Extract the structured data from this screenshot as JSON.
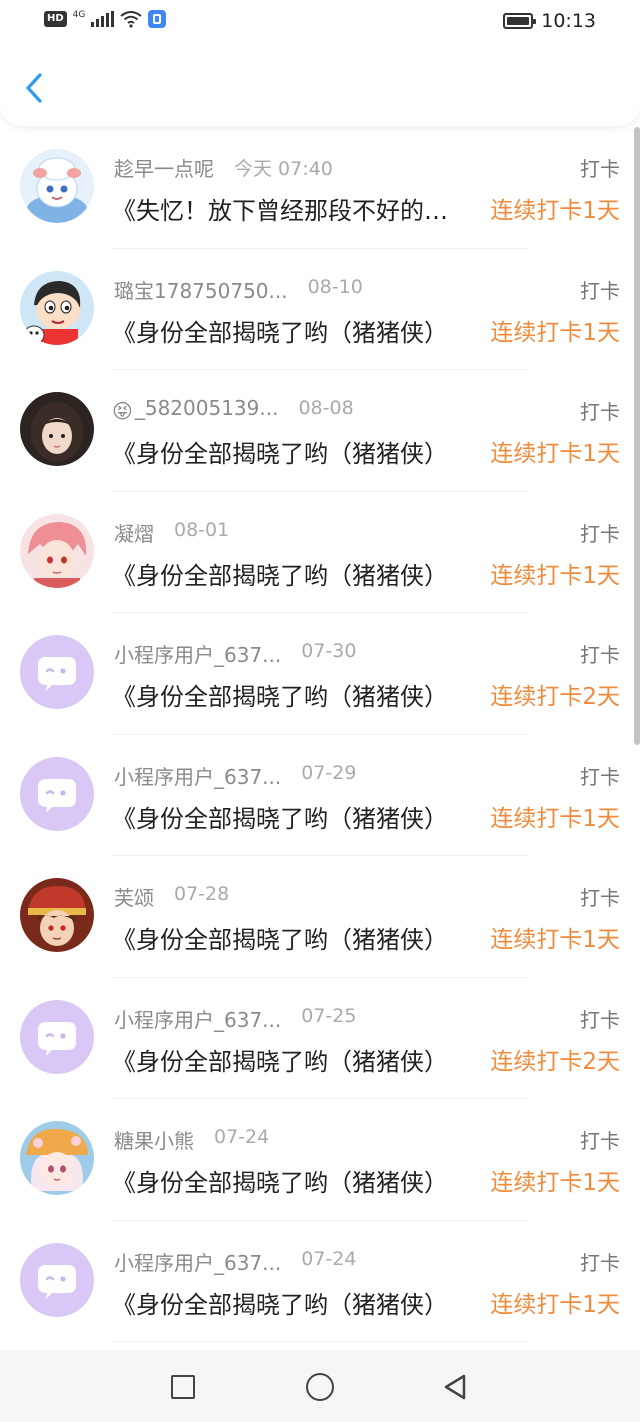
{
  "status_bar": {
    "hd": "HD",
    "network": "4G",
    "time": "10:13",
    "icons": [
      "signal-icon",
      "wifi-icon",
      "app-notification-icon",
      "battery-icon"
    ]
  },
  "header": {
    "back_icon": "chevron-left-icon"
  },
  "records": [
    {
      "username": "趁早一点呢",
      "emoji": "",
      "time": "今天 07:40",
      "type": "打卡",
      "title": "《失忆！放下曾经那段不好的回忆",
      "streak": "连续打卡1天",
      "avatar": "sheep-cartoon"
    },
    {
      "username": "璐宝178750750...",
      "emoji": "",
      "time": "08-10",
      "type": "打卡",
      "title": "《身份全部揭晓了哟（猪猪侠）",
      "streak": "连续打卡1天",
      "avatar": "crayon-boy"
    },
    {
      "username": "_582005139...",
      "emoji": "😝",
      "time": "08-08",
      "type": "打卡",
      "title": "《身份全部揭晓了哟（猪猪侠）",
      "streak": "连续打卡1天",
      "avatar": "girl-photo"
    },
    {
      "username": "凝熠",
      "emoji": "",
      "time": "08-01",
      "type": "打卡",
      "title": "《身份全部揭晓了哟（猪猪侠）",
      "streak": "连续打卡1天",
      "avatar": "pink-hair-anime"
    },
    {
      "username": "小程序用户_637...",
      "emoji": "",
      "time": "07-30",
      "type": "打卡",
      "title": "《身份全部揭晓了哟（猪猪侠）",
      "streak": "连续打卡2天",
      "avatar": "default"
    },
    {
      "username": "小程序用户_637...",
      "emoji": "",
      "time": "07-29",
      "type": "打卡",
      "title": "《身份全部揭晓了哟（猪猪侠）",
      "streak": "连续打卡1天",
      "avatar": "default"
    },
    {
      "username": "芙颂",
      "emoji": "",
      "time": "07-28",
      "type": "打卡",
      "title": "《身份全部揭晓了哟（猪猪侠）",
      "streak": "连续打卡1天",
      "avatar": "red-hat-anime"
    },
    {
      "username": "小程序用户_637...",
      "emoji": "",
      "time": "07-25",
      "type": "打卡",
      "title": "《身份全部揭晓了哟（猪猪侠）",
      "streak": "连续打卡2天",
      "avatar": "default"
    },
    {
      "username": "糖果小熊",
      "emoji": "",
      "time": "07-24",
      "type": "打卡",
      "title": "《身份全部揭晓了哟（猪猪侠）",
      "streak": "连续打卡1天",
      "avatar": "flower-hat-anime"
    },
    {
      "username": "小程序用户_637...",
      "emoji": "",
      "time": "07-24",
      "type": "打卡",
      "title": "《身份全部揭晓了哟（猪猪侠）",
      "streak": "连续打卡1天",
      "avatar": "default"
    }
  ],
  "nav_bar": {
    "icons": [
      "recent-apps-icon",
      "home-icon",
      "back-icon"
    ]
  },
  "colors": {
    "accent": "#f08b3c",
    "back_arrow": "#2f9bf0",
    "default_avatar": "#d9c8f5"
  }
}
